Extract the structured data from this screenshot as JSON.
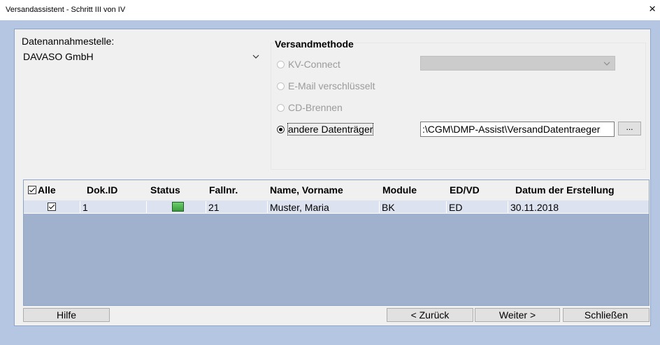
{
  "window": {
    "title": "Versandassistent - Schritt III von IV",
    "close_glyph": "×"
  },
  "datenannahmestelle": {
    "label": "Datenannahmestelle:",
    "selected": "DAVASO GmbH"
  },
  "versandmethode": {
    "title": "Versandmethode",
    "options": [
      {
        "label": "KV-Connect",
        "enabled": false,
        "selected": false
      },
      {
        "label": "E-Mail verschlüsselt",
        "enabled": false,
        "selected": false
      },
      {
        "label": "CD-Brennen",
        "enabled": false,
        "selected": false
      },
      {
        "label": "andere Datenträger",
        "enabled": true,
        "selected": true
      }
    ],
    "kv_connect_combo_value": "",
    "path_value": ":\\CGM\\DMP-Assist\\VersandDatentraeger",
    "browse_label": "..."
  },
  "grid": {
    "columns": [
      "Alle",
      "Dok.ID",
      "Status",
      "Fallnr.",
      "Name, Vorname",
      "Module",
      "ED/VD",
      "Datum der Erstellung"
    ],
    "rows": [
      {
        "checked": true,
        "dok_id": "1",
        "status": "green",
        "fallnr": "21",
        "name": "Muster, Maria",
        "module": "BK",
        "ed_vd": "ED",
        "datum": "30.11.2018"
      }
    ]
  },
  "buttons": {
    "hilfe": "Hilfe",
    "zurueck": "< Zurück",
    "weiter": "Weiter >",
    "schliessen": "Schließen"
  },
  "colors": {
    "frame": "#b4c6e1",
    "panel": "#f0f0f0",
    "grid_empty": "#9fb1cc",
    "row_bg": "#dce2ef",
    "status_green": "#4cb84c"
  }
}
